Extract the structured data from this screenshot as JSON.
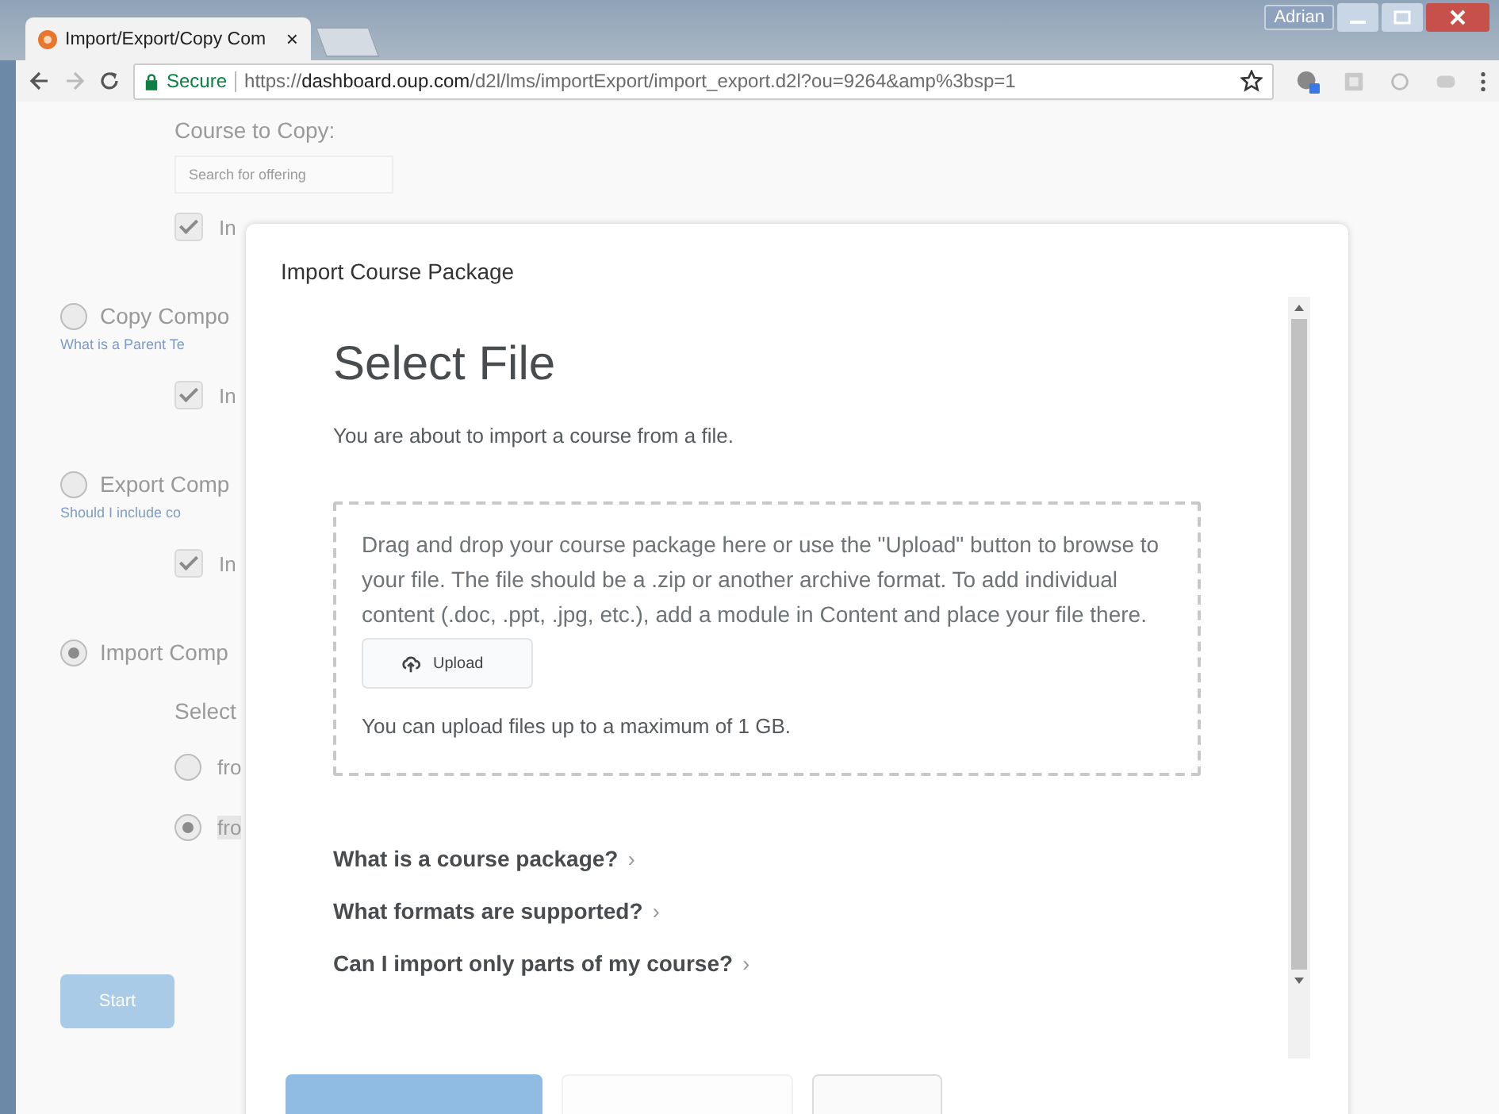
{
  "browser": {
    "tab_title": "Import/Export/Copy Com",
    "tab_close": "×",
    "user": "Adrian",
    "secure_label": "Secure",
    "url_scheme": "https://",
    "url_host": "dashboard.oup.com",
    "url_path": "/d2l/lms/importExport/import_export.d2l?ou=9264&amp%3bsp=1"
  },
  "page": {
    "course_label": "Course to Copy:",
    "search": {
      "placeholder": "Search for offering"
    },
    "top_check": {
      "label": "In",
      "checked": true
    },
    "sections": [
      {
        "title": "Copy Compo",
        "selected": false,
        "link": "What is a Parent Te",
        "options": [
          {
            "kind": "check",
            "label": "In",
            "checked": true
          }
        ]
      },
      {
        "title": "Export Comp",
        "selected": false,
        "link": "Should I include co",
        "options": [
          {
            "kind": "check",
            "label": "In",
            "checked": true
          }
        ]
      },
      {
        "title": "Import Comp",
        "selected": true,
        "sub_label": "Select",
        "options": [
          {
            "kind": "radio",
            "label": "fro",
            "selected": false
          },
          {
            "kind": "radio",
            "label": "fro",
            "selected": true
          }
        ]
      }
    ],
    "start_button": "Start"
  },
  "dialog": {
    "title": "Import Course Package",
    "heading": "Select File",
    "intro": "You are about to import a course from a file.",
    "drop_text": "Drag and drop your course package here or use the \"Upload\" button to browse to your file. The file should be a .zip or another archive format. To add individual content (.doc, .ppt, .jpg, etc.), add a module in Content and place your file there.",
    "upload_button": "Upload",
    "limit_text": "You can upload files up to a maximum of 1 GB.",
    "faq": [
      {
        "label": "What is a course package?",
        "chevron": "›"
      },
      {
        "label": "What formats are supported?",
        "chevron": "›"
      },
      {
        "label": "Can I import only parts of my course?",
        "chevron": "›"
      }
    ],
    "buttons": [
      {
        "kind": "primary"
      },
      {
        "kind": "disabled"
      },
      {
        "kind": "normal"
      }
    ]
  }
}
